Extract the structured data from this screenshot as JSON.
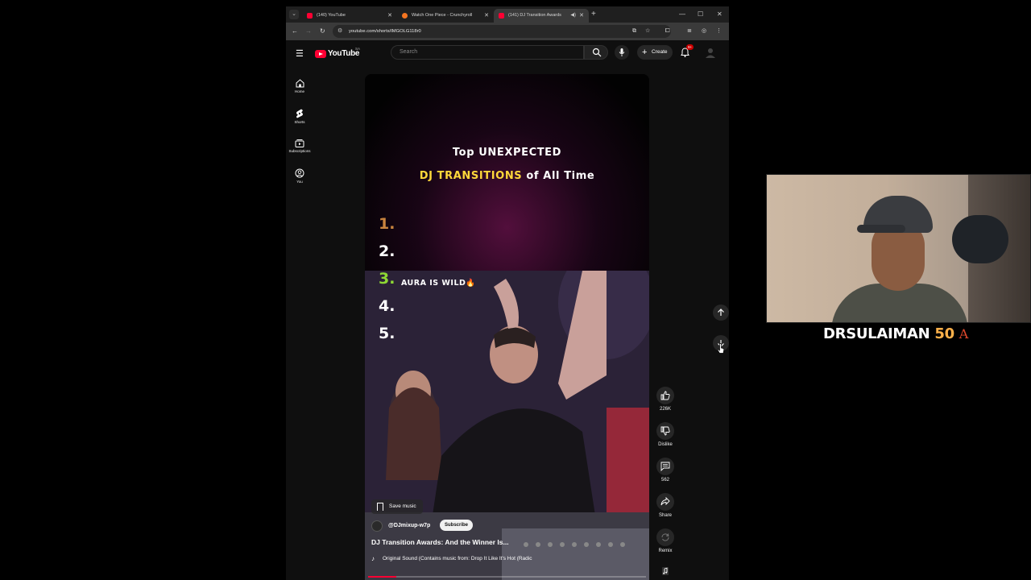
{
  "browser": {
    "tabs": [
      {
        "title": "(140) YouTube",
        "favicon_color": "#ff0033",
        "active": false
      },
      {
        "title": "Watch One Piece - Crunchyroll",
        "favicon_color": "#f47521",
        "active": false
      },
      {
        "title": "(141) DJ Transition Awards",
        "favicon_color": "#ff0033",
        "active": true
      }
    ],
    "url": "youtube.com/shorts/IMGOLG118r0",
    "icons": [
      "tab-list-icon",
      "back-icon",
      "forward-icon",
      "reload-icon",
      "site-info-icon",
      "install-icon",
      "star-icon",
      "extensions-icon",
      "reading-list-icon",
      "profile-icon",
      "menu-icon"
    ]
  },
  "youtube": {
    "logo_text": "YouTube",
    "country_code": "SA",
    "search_placeholder": "Search",
    "create_label": "Create",
    "notification_count": "9+",
    "sidebar": [
      {
        "label": "Home",
        "icon": "home-icon"
      },
      {
        "label": "Shorts",
        "icon": "shorts-icon"
      },
      {
        "label": "Subscriptions",
        "icon": "subscriptions-icon"
      },
      {
        "label": "You",
        "icon": "you-icon"
      }
    ]
  },
  "short": {
    "title_line1": "Top UNEXPECTED",
    "title_line2_highlight": "DJ TRANSITIONS",
    "title_line2_rest": " of All Time",
    "ranks": [
      "1.",
      "2.",
      "3.",
      "4.",
      "5."
    ],
    "rank3_caption": "AURA IS WILD",
    "rank3_emoji": "🔥",
    "save_music_label": "Save music",
    "channel": "@DJmixup-w7p",
    "subscribe_label": "Subscribe",
    "video_title": "DJ Transition Awards: And the Winner Is...",
    "sound": "Original Sound (Contains music from: Drop It Like It's Hot (Radic",
    "progress": 0.1
  },
  "actions": {
    "likes": "226K",
    "dislike_label": "Dislike",
    "comments": "562",
    "share_label": "Share",
    "remix_label": "Remix"
  },
  "overlay": {
    "streamer_name": "DRSULAIMAN",
    "streamer_number": "50",
    "streamer_suffix": "A"
  },
  "colors": {
    "youtube_red": "#ff0033",
    "title_yellow": "#ffd83a",
    "rank1": "#c8843e",
    "rank3": "#8ed834"
  }
}
